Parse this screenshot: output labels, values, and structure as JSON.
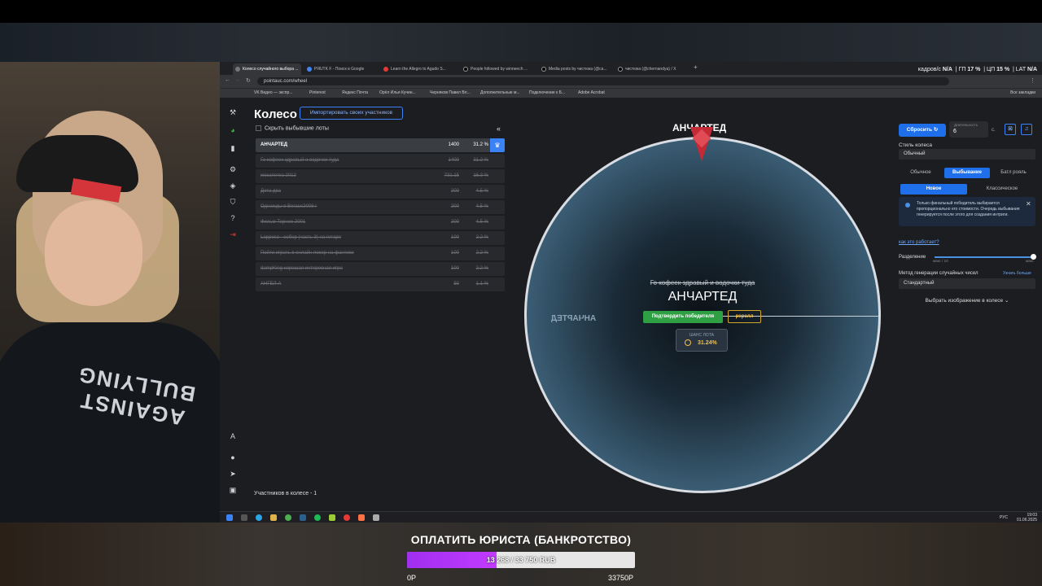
{
  "browser": {
    "tabs": [
      {
        "label": "Колесо случайного выбора ..."
      },
      {
        "label": "PЯUTK F - Поиск в Google"
      },
      {
        "label": "Learn the Allegro to Agudo S..."
      },
      {
        "label": "People followed by winneech ..."
      },
      {
        "label": "Media posts by чистюка (@ca..."
      },
      {
        "label": "чистюка (@chernandya) / X"
      }
    ],
    "stats": {
      "fps_label": "кадров/с",
      "fps": "N/A",
      "gpu_label": "ГП",
      "gpu": "17 %",
      "cpu_label": "ЦП",
      "cpu": "15 %",
      "lat_label": "LAT",
      "lat": "N/A"
    },
    "url": "pointauc.com/wheel",
    "bookmarks": [
      "VK Видео — экспр...",
      "Pinterest",
      "Яндекс Почта",
      "Орёл Илья Кучин...",
      "Черняков Павел Вл...",
      "Дополнительные м...",
      "Подключение к Б...",
      "Adobe Acrobat"
    ],
    "other_bookmarks": "Все закладки"
  },
  "wheel_page": {
    "title": "Колесо",
    "import_label": "Импортировать своих участников",
    "hide_label": "Скрыть выбывшие лоты",
    "collapse_icon": "«",
    "lots": [
      {
        "name": "АНЧАРТЕД",
        "amount": "1400",
        "percent": "31.2 %",
        "winner": true
      },
      {
        "name": "Го кофеек здравый и водочки туда",
        "amount": "1400",
        "percent": "31.2 %"
      },
      {
        "name": "мокапетка 2012",
        "amount": "731.15",
        "percent": "16.3 %"
      },
      {
        "name": "Дота два",
        "amount": "200",
        "percent": "4.5 %"
      },
      {
        "name": "Однажды в Вегасе2008 г",
        "amount": "200",
        "percent": "4.5 %"
      },
      {
        "name": "Фильм Торнео 2001",
        "amount": "200",
        "percent": "4.5 %"
      },
      {
        "name": "Lapposo - собор (часть 3) на гитаре",
        "amount": "100",
        "percent": "2.2 %"
      },
      {
        "name": "Пойти играть в онлайн покер на фантики",
        "amount": "100",
        "percent": "2.2 %"
      },
      {
        "name": "dampKing хорошая интересная игра",
        "amount": "100",
        "percent": "2.2 %"
      },
      {
        "name": "АНГЕЛ-А",
        "amount": "50",
        "percent": "1.1 %"
      }
    ],
    "participants": "Участников в колесе - 1",
    "winner_top": "АНЧАРТЕД",
    "mirror_label": "АНЧАРТЕД",
    "prev_eliminated": "Го кофеек здравый и водочки туда",
    "current_winner": "АНЧАРТЕД",
    "confirm_label": "Подтвердить победителя",
    "reroll_label": "реролл",
    "chance_label": "ШАНС ЛОТА",
    "chance_value": "31.24%"
  },
  "settings": {
    "reset_label": "Сбросить",
    "duration_label": "Длительность",
    "duration_value": "6",
    "duration_unit": "с.",
    "style_label": "Стиль колеса",
    "style_value": "Обычный",
    "modes": [
      "Обычное",
      "Выбывание",
      "Батл рояль"
    ],
    "submodes": [
      "Новое",
      "Классическое"
    ],
    "info_text": "Только финальный победитель выбирается пропорционально его стоимости. Очередь выбывания генерируется после этого для создания интриги.",
    "how_link": "как это работает?",
    "split_label": "Разделение",
    "split_min": "макс / 10",
    "split_max": "макс",
    "split_value": 1,
    "rng_label": "Метод генерации случайных чисел",
    "rng_more": "Узнать больше",
    "rng_value": "Стандартный",
    "image_select": "Выбрать изображение в колесе"
  },
  "taskbar": {
    "lang": "РУС",
    "time": "19:03",
    "date": "01.06.2025"
  },
  "donation": {
    "title": "ОПЛАТИТЬ ЮРИСТА (БАНКРОТСТВО)",
    "progress_text": "13 268 / 33 750 RUB",
    "current": 13268,
    "goal": 33750,
    "min_label": "0Р",
    "max_label": "33750Р"
  },
  "webcam": {
    "shirt_text": "AGAINST BULLYING"
  },
  "colors": {
    "accent": "#1f6feb",
    "confirm": "#2ea043",
    "reroll": "#d4a72c",
    "donation": "#b336f7"
  }
}
